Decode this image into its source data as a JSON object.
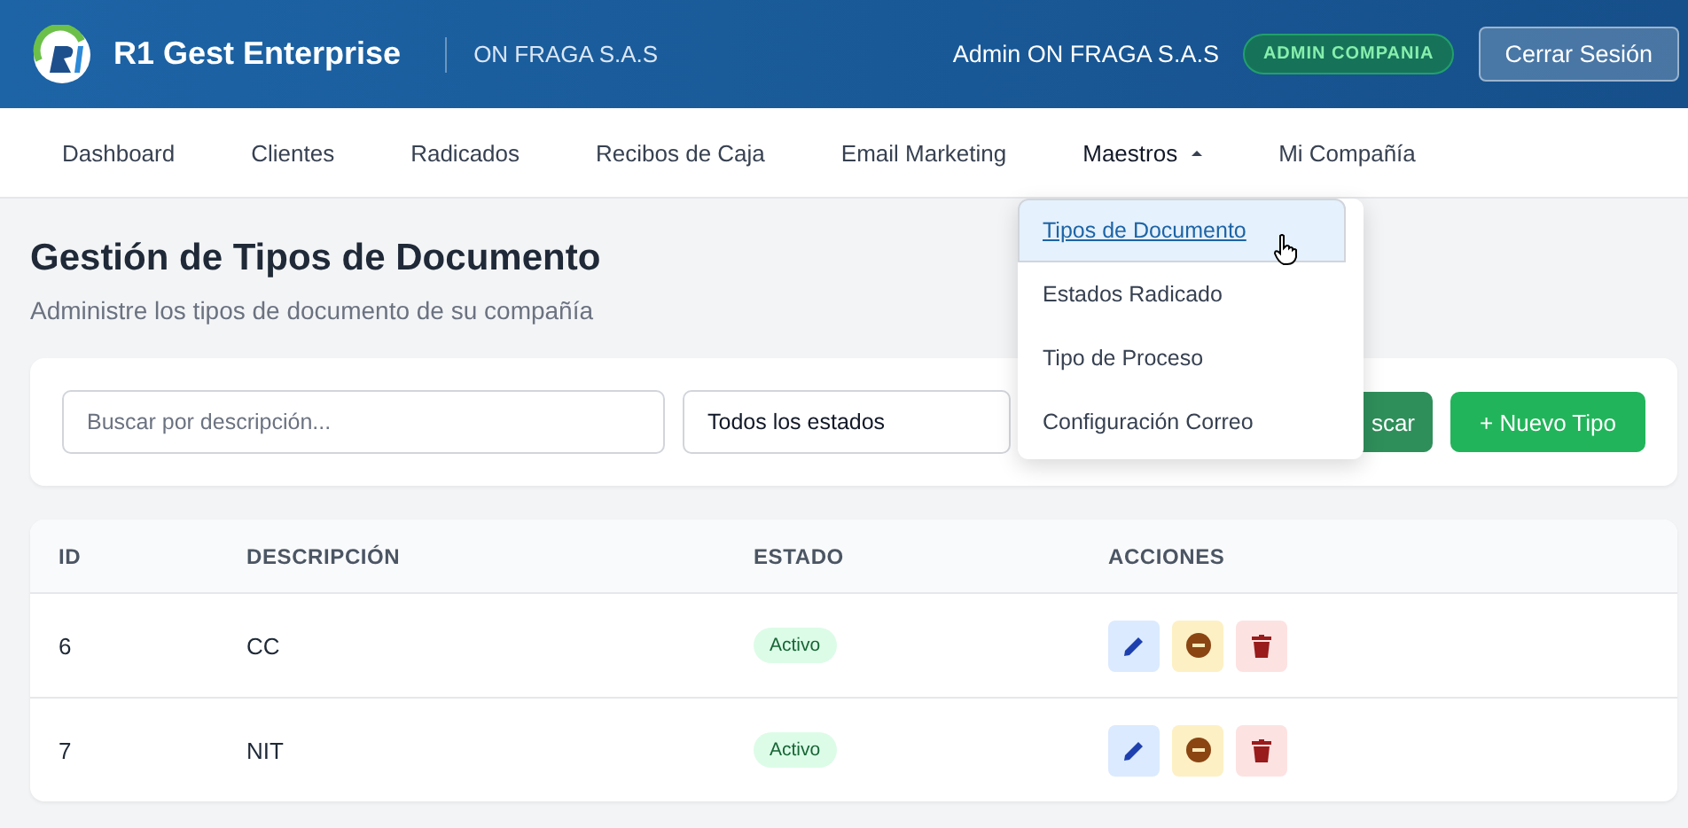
{
  "header": {
    "app_name": "R1 Gest Enterprise",
    "company": "ON FRAGA S.A.S",
    "user": "Admin ON FRAGA S.A.S",
    "role_badge": "ADMIN COMPANIA",
    "logout_button": "Cerrar Sesión"
  },
  "nav": [
    {
      "label": "Dashboard",
      "expanded": false,
      "kind": "link"
    },
    {
      "label": "Clientes",
      "expanded": false,
      "kind": "link"
    },
    {
      "label": "Radicados",
      "expanded": false,
      "kind": "link"
    },
    {
      "label": "Recibos de Caja",
      "expanded": false,
      "kind": "link"
    },
    {
      "label": "Email Marketing",
      "expanded": false,
      "kind": "link"
    },
    {
      "label": "Maestros",
      "expanded": true,
      "kind": "dropdown"
    },
    {
      "label": "Mi Compañía",
      "expanded": false,
      "kind": "link"
    }
  ],
  "dropdown_menu": [
    {
      "label": "Tipos de Documento",
      "selected": true
    },
    {
      "label": "Estados Radicado",
      "selected": false
    },
    {
      "label": "Tipo de Proceso",
      "selected": false
    },
    {
      "label": "Configuración Correo",
      "selected": false
    }
  ],
  "page": {
    "title": "Gestión de Tipos de Documento",
    "subtitle": "Administre los tipos de documento de su compañía"
  },
  "filters": {
    "search": {
      "placeholder": "Buscar por descripción..."
    },
    "status_select": "Todos los estados",
    "search_button": "scar",
    "new_button": "+ Nuevo Tipo"
  },
  "table": {
    "columns": [
      "ID",
      "DESCRIPCIÓN",
      "ESTADO",
      "ACCIONES"
    ],
    "rows": [
      {
        "id": "6",
        "description": "CC",
        "status": "Activo"
      },
      {
        "id": "7",
        "description": "NIT",
        "status": "Activo"
      }
    ]
  }
}
